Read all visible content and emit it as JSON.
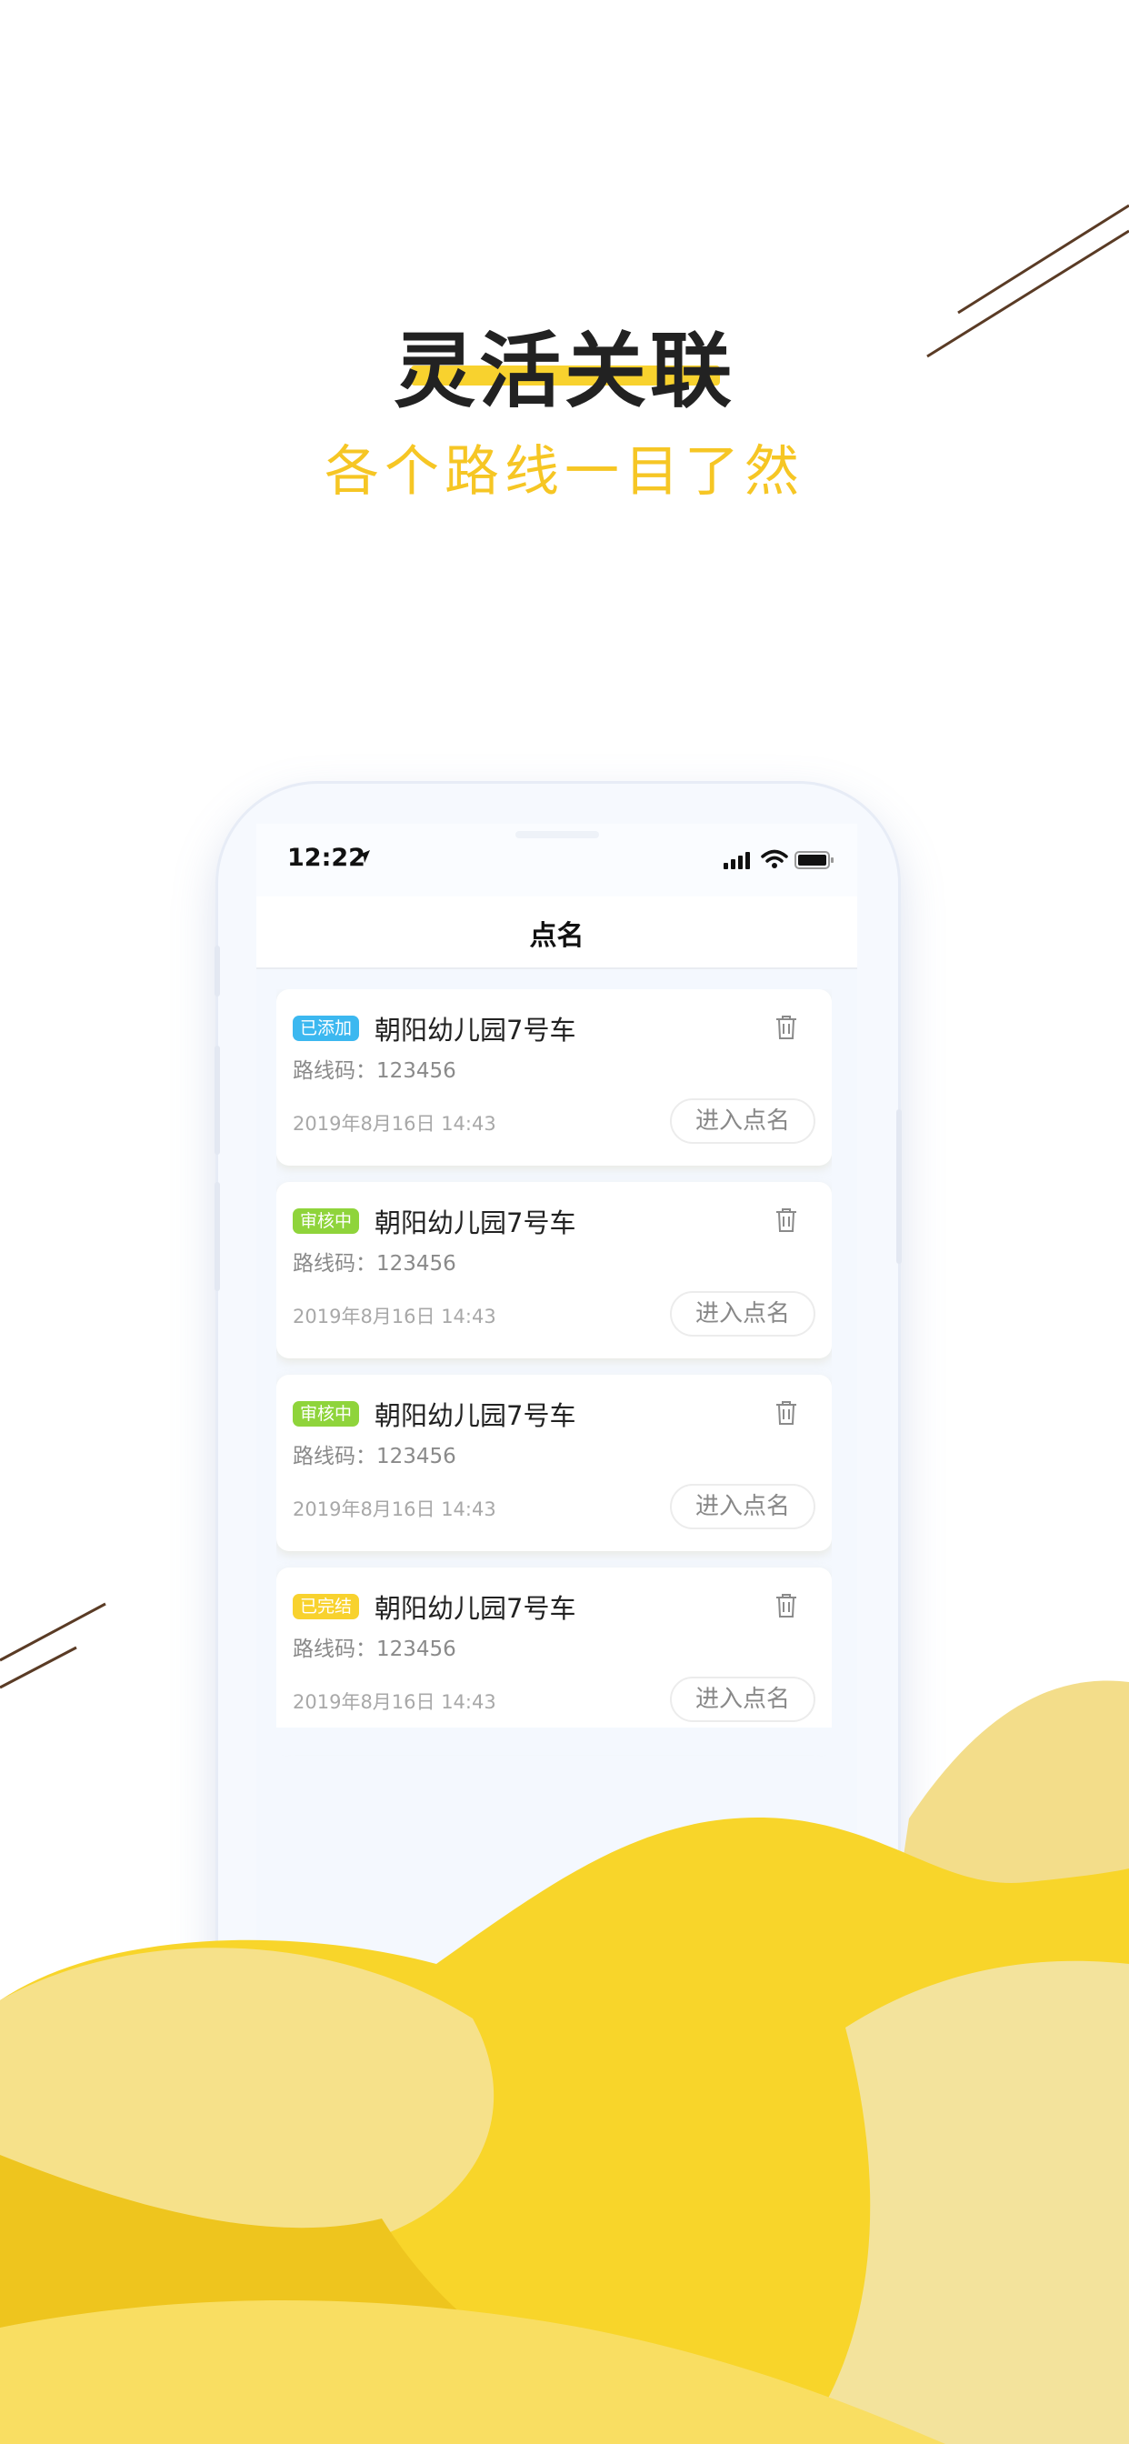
{
  "promo": {
    "headline": "灵活关联",
    "subhead": "各个路线一目了然"
  },
  "status_bar": {
    "time": "12:22",
    "icons": [
      "location-arrow-icon",
      "cell-signal-icon",
      "wifi-icon",
      "battery-icon"
    ]
  },
  "nav": {
    "title": "点名"
  },
  "colors": {
    "badge_added": "#3cb8f0",
    "badge_reviewing": "#8fd43b",
    "badge_done": "#f8d22e",
    "accent_yellow": "#f6c624"
  },
  "cards": [
    {
      "status": "已添加",
      "title": "朝阳幼儿园7号车",
      "route": "路线码：123456",
      "datetime": "2019年8月16日 14:43",
      "action": "进入点名"
    },
    {
      "status": "审核中",
      "title": "朝阳幼儿园7号车",
      "route": "路线码：123456",
      "datetime": "2019年8月16日 14:43",
      "action": "进入点名"
    },
    {
      "status": "审核中",
      "title": "朝阳幼儿园7号车",
      "route": "路线码：123456",
      "datetime": "2019年8月16日 14:43",
      "action": "进入点名"
    },
    {
      "status": "已完结",
      "title": "朝阳幼儿园7号车",
      "route": "路线码：123456",
      "datetime": "2019年8月16日 14:43",
      "action": "进入点名"
    }
  ]
}
